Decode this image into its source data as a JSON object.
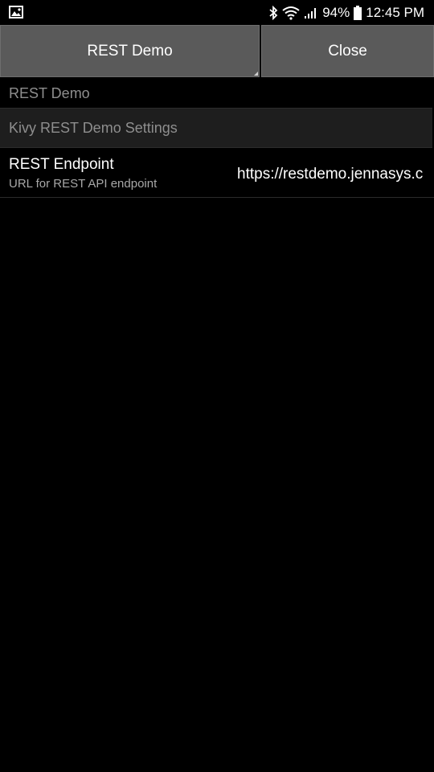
{
  "status_bar": {
    "notification_icon": "image-icon",
    "bluetooth_icon": "bluetooth-icon",
    "wifi_icon": "wifi-icon",
    "signal_icon": "signal-icon",
    "battery_percent": "94%",
    "battery_icon": "battery-icon",
    "time": "12:45 PM"
  },
  "action_bar": {
    "title_label": "REST Demo",
    "close_label": "Close"
  },
  "menu": {
    "items": [
      {
        "label": "REST Demo"
      }
    ]
  },
  "panel": {
    "title": "Kivy REST Demo Settings",
    "settings": [
      {
        "title": "REST Endpoint",
        "description": "URL for REST API endpoint",
        "value": "https://restdemo.jennasys.c"
      }
    ]
  },
  "colors": {
    "background": "#000000",
    "button_bg": "#5a5a5a",
    "panel_header_bg": "#1e1e1e",
    "muted_text": "#8e8e8e"
  }
}
